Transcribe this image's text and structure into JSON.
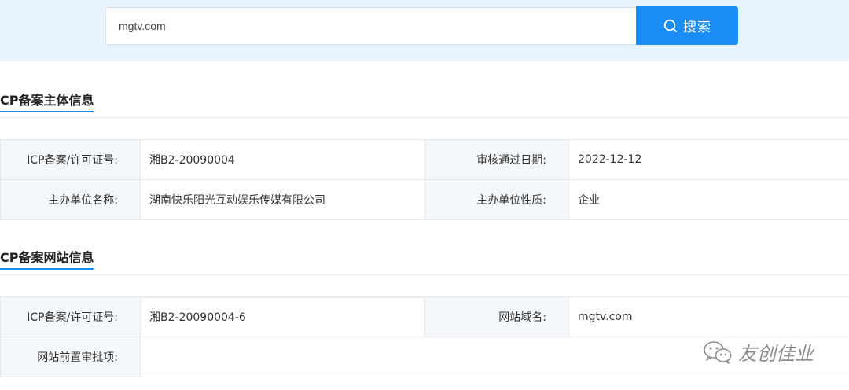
{
  "search": {
    "value": "mgtv.com",
    "button_label": "搜索",
    "accent_color": "#1a8cf5"
  },
  "sections": [
    {
      "title": "CP备案主体信息",
      "rows": [
        {
          "label1": "ICP备案/许可证号:",
          "value1": "湘B2-20090004",
          "label2": "审核通过日期:",
          "value2": "2022-12-12"
        },
        {
          "label1": "主办单位名称:",
          "value1": "湖南快乐阳光互动娱乐传媒有限公司",
          "label2": "主办单位性质:",
          "value2": "企业"
        }
      ]
    },
    {
      "title": "CP备案网站信息",
      "rows": [
        {
          "label1": "ICP备案/许可证号:",
          "value1": "湘B2-20090004-6",
          "label2": "网站域名:",
          "value2": "mgtv.com"
        },
        {
          "label1": "网站前置审批项:",
          "value1": "",
          "label2": "",
          "value2": ""
        }
      ]
    }
  ],
  "watermark": {
    "text": "友创佳业",
    "icon": "wechat-icon"
  }
}
